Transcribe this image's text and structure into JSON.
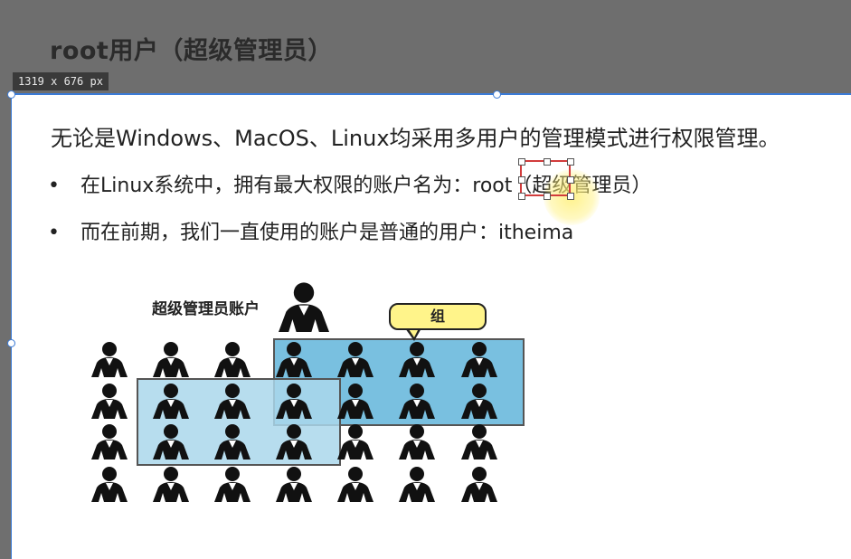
{
  "header": {
    "title": "root用户（超级管理员）",
    "dimension_badge": "1319 x 676  px"
  },
  "slide": {
    "intro": "无论是Windows、MacOS、Linux均采用多用户的管理模式进行权限管理。",
    "bullets": [
      {
        "marker": "•",
        "text_before": "在Linux系统中，拥有最大权限的账户名为：",
        "highlight": "root",
        "text_after": "（超级管理员）"
      },
      {
        "marker": "•",
        "text": "而在前期，我们一直使用的账户是普通的用户：itheima"
      }
    ]
  },
  "diagram": {
    "superuser_label": "超级管理员账户",
    "group_label": "组",
    "colors": {
      "group_primary": "#79c0e0",
      "group_secondary": "#aad7eb",
      "callout_fill": "#fff48a",
      "person": "#111111"
    }
  },
  "colors": {
    "selection_border": "#3b7bd6",
    "highlight_box": "#d23c3c"
  }
}
